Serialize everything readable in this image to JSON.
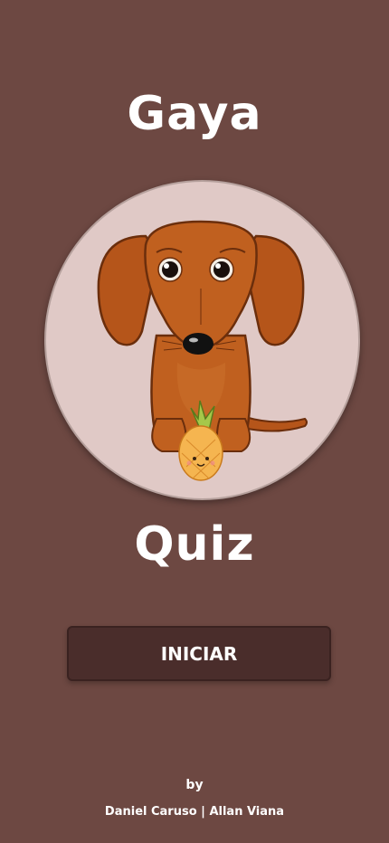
{
  "app": {
    "title_top": "Gaya",
    "title_bottom": "Quiz"
  },
  "mascot": {
    "icon": "dachshund-with-pineapple-icon"
  },
  "start_button": {
    "label": "INICIAR"
  },
  "credits": {
    "by": "by",
    "names": "Daniel Caruso | Allan Viana"
  },
  "colors": {
    "background": "#6d4842",
    "circle": "#e0c9c6",
    "button": "#4a2d2b",
    "text": "#ffffff"
  }
}
